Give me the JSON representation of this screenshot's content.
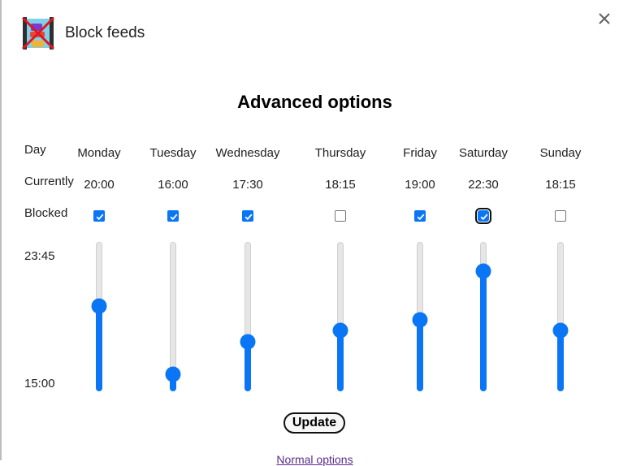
{
  "header": {
    "app_title": "Block feeds",
    "app_icon": "block-feeds-icon",
    "close_icon": "close-icon"
  },
  "heading": "Advanced options",
  "row_labels": {
    "day": "Day",
    "currently": "Currently",
    "blocked": "Blocked"
  },
  "scale": {
    "max_label": "23:45",
    "min_label": "15:00"
  },
  "days": [
    {
      "name": "Monday",
      "current": "20:00",
      "blocked": true,
      "slider_fraction": 0.57
    },
    {
      "name": "Tuesday",
      "current": "16:00",
      "blocked": true,
      "slider_fraction": 0.07
    },
    {
      "name": "Wednesday",
      "current": "17:30",
      "blocked": true,
      "slider_fraction": 0.31
    },
    {
      "name": "Thursday",
      "current": "18:15",
      "blocked": false,
      "slider_fraction": 0.39
    },
    {
      "name": "Friday",
      "current": "19:00",
      "blocked": true,
      "slider_fraction": 0.47
    },
    {
      "name": "Saturday",
      "current": "22:30",
      "blocked": true,
      "slider_fraction": 0.83
    },
    {
      "name": "Sunday",
      "current": "18:15",
      "blocked": false,
      "slider_fraction": 0.39
    }
  ],
  "focused_checkbox": "Saturday",
  "update_label": "Update",
  "normal_options_label": "Normal options",
  "colors": {
    "accent": "#0b76f5",
    "track": "#e6e6e6",
    "link": "#5b2c8a"
  }
}
